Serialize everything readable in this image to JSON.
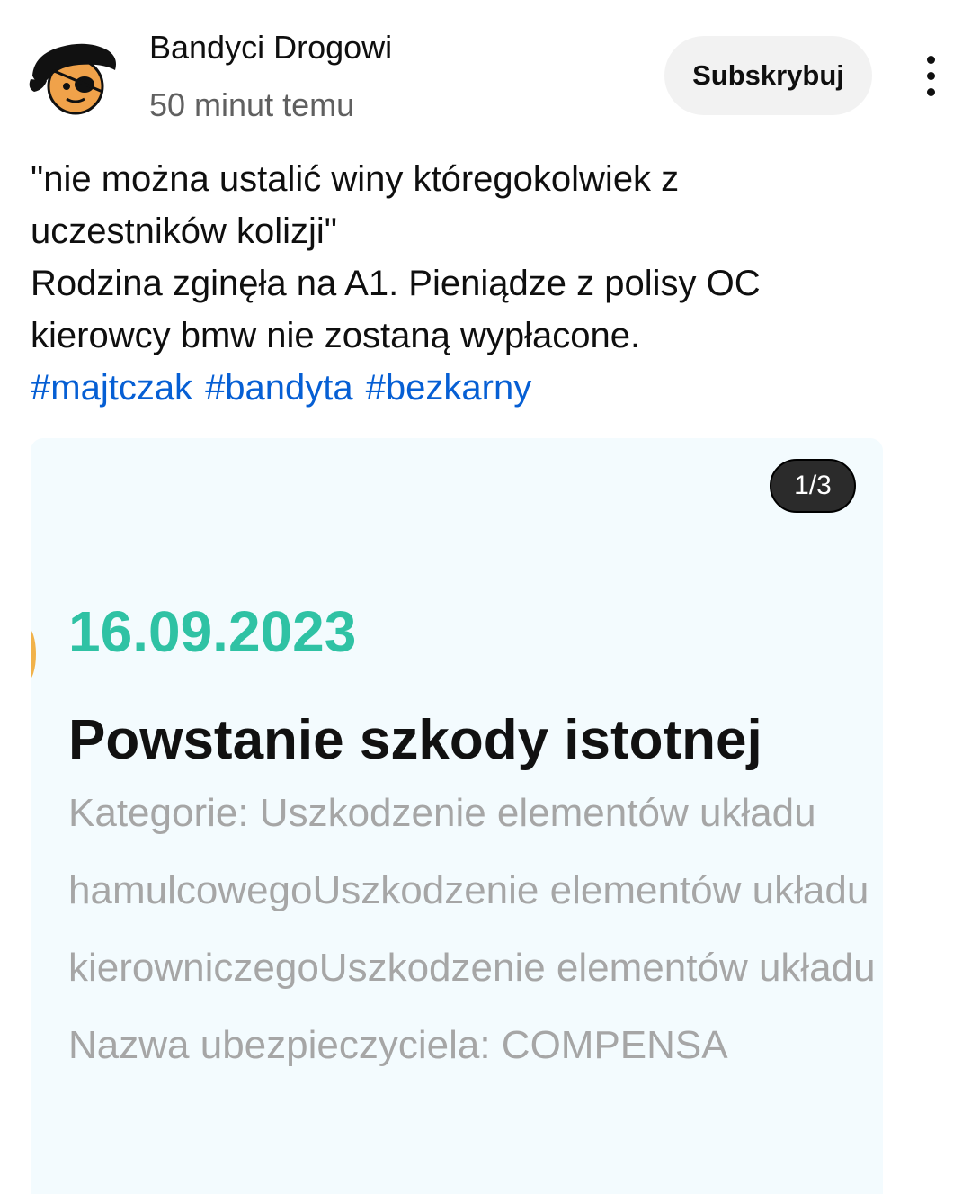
{
  "post": {
    "channel_name": "Bandyci Drogowi",
    "time_ago": "50 minut temu",
    "subscribe_label": "Subskrybuj",
    "more_icon": "more-vertical-icon",
    "text_lines": [
      "\"nie można ustalić winy któregokolwiek z",
      "uczestników kolizji\"",
      "Rodzina zginęła na A1. Pieniądze z polisy OC",
      "kierowcy bmw nie zostaną wypłacone."
    ],
    "hashtags": [
      "#majtczak",
      "#bandyta",
      "#bezkarny"
    ]
  },
  "card": {
    "counter": "1/3",
    "date": "16.09.2023",
    "title": "Powstanie szkody istotnej",
    "details": [
      "Kategorie: Uszkodzenie elementów układu",
      "hamulcowegoUszkodzenie elementów układu",
      "kierowniczegoUszkodzenie elementów układu",
      "Nazwa ubezpieczyciela: COMPENSA"
    ]
  },
  "colors": {
    "hashtag": "#065fd4",
    "date": "#2fc2a4",
    "card_bg": "#f3fbfe",
    "subscribe_bg": "#f2f2f2"
  }
}
